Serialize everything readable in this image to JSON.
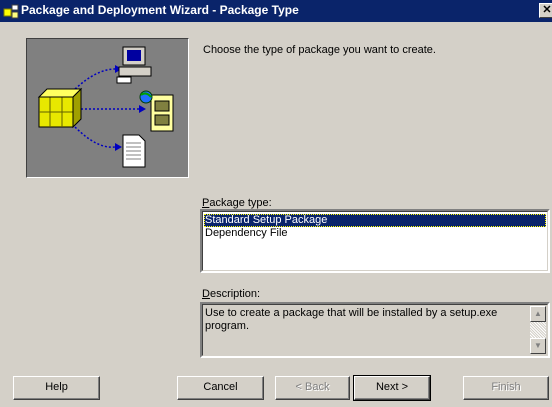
{
  "window": {
    "title": "Package and Deployment Wizard - Package Type",
    "close_glyph": "✕",
    "icon": "package-wizard-icon"
  },
  "instruction": "Choose the type of package you want to create.",
  "package_type": {
    "label_accel": "P",
    "label_rest": "ackage type:",
    "items": [
      {
        "label": "Standard Setup Package",
        "selected": true
      },
      {
        "label": "Dependency File",
        "selected": false
      }
    ]
  },
  "description": {
    "label_accel": "D",
    "label_rest": "escription:",
    "text": "Use to create a package that will be installed by a setup.exe program."
  },
  "buttons": {
    "help": "Help",
    "cancel": "Cancel",
    "back": "< Back",
    "next": "Next >",
    "finish": "Finish"
  },
  "colors": {
    "titlebar": "#0a246a",
    "dialog": "#d4d0c8",
    "illustration_bg": "#808080",
    "selection": "#0a246a"
  }
}
